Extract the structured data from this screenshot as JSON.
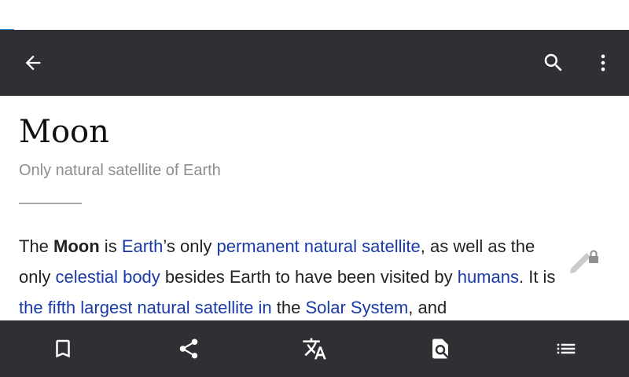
{
  "article": {
    "title": "Moon",
    "description": "Only natural satellite of Earth",
    "paragraph": [
      {
        "t": "text",
        "v": "The "
      },
      {
        "t": "bold",
        "v": "Moon"
      },
      {
        "t": "text",
        "v": " is "
      },
      {
        "t": "link",
        "v": "Earth"
      },
      {
        "t": "text",
        "v": "’s only "
      },
      {
        "t": "link",
        "v": "permanent natural satellite"
      },
      {
        "t": "text",
        "v": ", as well as the only "
      },
      {
        "t": "link",
        "v": "celestial body"
      },
      {
        "t": "text",
        "v": " besides Earth to have been visited by "
      },
      {
        "t": "link",
        "v": "humans"
      },
      {
        "t": "text",
        "v": ". It is "
      },
      {
        "t": "link",
        "v": "the fifth largest natural satellite in"
      },
      {
        "t": "text",
        "v": " the "
      },
      {
        "t": "link",
        "v": "Solar System"
      },
      {
        "t": "text",
        "v": ", and"
      }
    ]
  },
  "toolbar": {
    "top": [
      "back-arrow-icon",
      "search-icon",
      "more-vert-icon"
    ],
    "bottom": [
      "bookmark-icon",
      "share-icon",
      "translate-icon",
      "find-in-page-icon",
      "contents-list-icon"
    ]
  },
  "colors": {
    "bar": "#2f3033",
    "link": "#1a3aa8",
    "progress": "#2f8fd8"
  }
}
